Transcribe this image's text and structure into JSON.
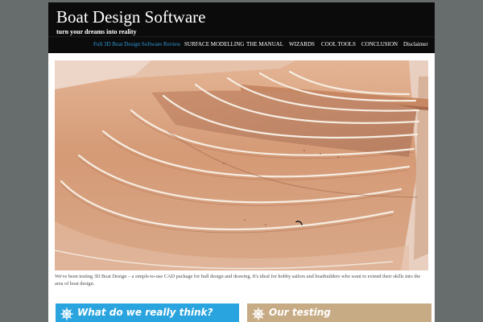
{
  "header": {
    "site_title": "Boat Design Software",
    "tagline": "turn your dreams into reality"
  },
  "nav": {
    "items": [
      {
        "label": "Full 3D Boat Design Software Review",
        "active": true
      },
      {
        "label": "SURFACE MODELLING",
        "active": false
      },
      {
        "label": "THE MANUAL",
        "active": false
      },
      {
        "label": "WIZARDS",
        "active": false
      },
      {
        "label": "COOL TOOLS",
        "active": false
      },
      {
        "label": "CONCLUSION",
        "active": false
      },
      {
        "label": "Disclaimer",
        "active": false
      }
    ]
  },
  "hero": {
    "image": "wooden-boat-hull-interior-photo",
    "loading_icon": "spinner-icon"
  },
  "content": {
    "intro": "We've been testing 3D Boat Design – a simple-to-use CAD package for hull design and drawing. It's ideal for hobby sailors and boatbuilders who want to extend their skills into the area of boat design."
  },
  "panels": [
    {
      "title": "What do we really think?",
      "icon": "ship-wheel-icon",
      "color": "#2aa4df"
    },
    {
      "title": "Our testing",
      "icon": "ship-wheel-icon",
      "color": "#c7ab84"
    }
  ],
  "colors": {
    "page_background": "#676d6c",
    "header_background": "#0b0b0b",
    "nav_active": "#2f98d8"
  }
}
